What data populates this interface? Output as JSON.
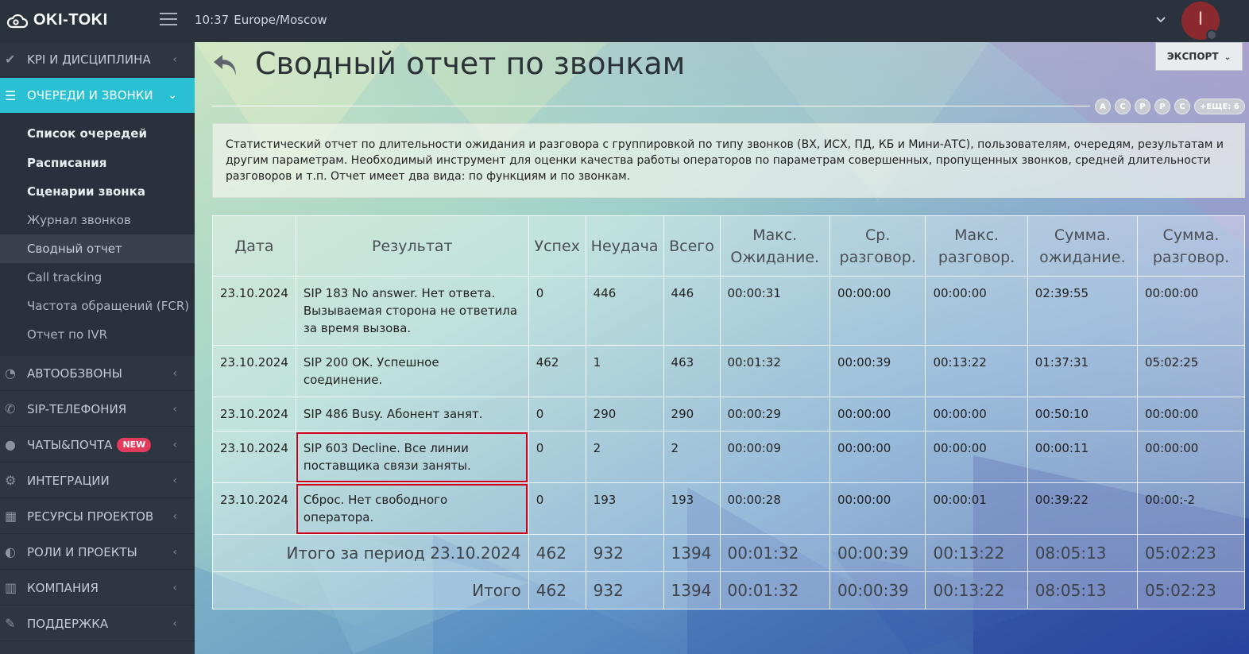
{
  "topbar": {
    "brand": "OKI-TOKI",
    "time": "10:37",
    "timezone": "Europe/Moscow",
    "user_initial": "I"
  },
  "sidebar": {
    "sections": [
      {
        "label": "KPI И ДИСЦИПЛИНА",
        "icon": "check-icon"
      },
      {
        "label": "ОЧЕРЕДИ И ЗВОНКИ",
        "icon": "list-icon",
        "active": true
      },
      {
        "label": "АВТООБЗВОНЫ",
        "icon": "clock-icon"
      },
      {
        "label": "SIP-ТЕЛЕФОНИЯ",
        "icon": "phone-icon"
      },
      {
        "label": "ЧАТЫ&ПОЧТА",
        "icon": "chat-icon",
        "badge": "NEW"
      },
      {
        "label": "ИНТЕГРАЦИИ",
        "icon": "cogs-icon"
      },
      {
        "label": "РЕСУРСЫ ПРОЕКТОВ",
        "icon": "grid-icon"
      },
      {
        "label": "РОЛИ И ПРОЕКТЫ",
        "icon": "toggle-icon"
      },
      {
        "label": "КОМПАНИЯ",
        "icon": "bar-chart-icon"
      },
      {
        "label": "ПОДДЕРЖКА",
        "icon": "wrench-icon"
      }
    ],
    "submenu": [
      {
        "label": "Список очередей",
        "bold": true
      },
      {
        "label": "Расписания",
        "bold": true
      },
      {
        "label": "Сценарии звонка",
        "bold": true
      },
      {
        "label": "Журнал звонков"
      },
      {
        "label": "Сводный отчет",
        "current": true
      },
      {
        "label": "Call tracking"
      },
      {
        "label": "Частота обращений (FCR)"
      },
      {
        "label": "Отчет по IVR"
      }
    ]
  },
  "page": {
    "title": "Сводный отчет по звонкам",
    "export_label": "ЭКСПОРТ",
    "chips": [
      "А",
      "С",
      "Р",
      "Р",
      "С"
    ],
    "chips_more": "+ЕЩЕ: 6",
    "description": "Статистический отчет по длительности ожидания и разговора с группировкой по типу звонков (ВХ, ИСХ, ПД, КБ и Мини-АТС), пользователям, очередям, результатам и другим параметрам. Необходимый инструмент для оценки качества работы операторов по параметрам совершенных, пропущенных звонков, средней длительности разговоров и т.п. Отчет имеет два вида: по функциям и по звонкам."
  },
  "table": {
    "headers": [
      "Дата",
      "Результат",
      "Успех",
      "Неудача",
      "Всего",
      "Макс. Ожидание.",
      "Ср. разговор.",
      "Макс. разговор.",
      "Сумма. ожидание.",
      "Сумма. разговор."
    ],
    "rows": [
      {
        "date": "23.10.2024",
        "result": "SIP 183 No answer. Нет ответа. Вызываемая сторона не ответила за время вызова.",
        "success": "0",
        "fail": "446",
        "total": "446",
        "max_wait": "00:00:31",
        "avg_talk": "00:00:00",
        "max_talk": "00:00:00",
        "sum_wait": "02:39:55",
        "sum_talk": "00:00:00",
        "highlight": false
      },
      {
        "date": "23.10.2024",
        "result": "SIP 200 OK. Успешное соединение.",
        "success": "462",
        "fail": "1",
        "total": "463",
        "max_wait": "00:01:32",
        "avg_talk": "00:00:39",
        "max_talk": "00:13:22",
        "sum_wait": "01:37:31",
        "sum_talk": "05:02:25",
        "highlight": false
      },
      {
        "date": "23.10.2024",
        "result": "SIP 486 Busy. Абонент занят.",
        "success": "0",
        "fail": "290",
        "total": "290",
        "max_wait": "00:00:29",
        "avg_talk": "00:00:00",
        "max_talk": "00:00:00",
        "sum_wait": "00:50:10",
        "sum_talk": "00:00:00",
        "highlight": false
      },
      {
        "date": "23.10.2024",
        "result": "SIP 603 Decline. Все линии поставщика связи заняты.",
        "success": "0",
        "fail": "2",
        "total": "2",
        "max_wait": "00:00:09",
        "avg_talk": "00:00:00",
        "max_talk": "00:00:00",
        "sum_wait": "00:00:11",
        "sum_talk": "00:00:00",
        "highlight": true
      },
      {
        "date": "23.10.2024",
        "result": "Сброс. Нет свободного оператора.",
        "success": "0",
        "fail": "193",
        "total": "193",
        "max_wait": "00:00:28",
        "avg_talk": "00:00:00",
        "max_talk": "00:00:01",
        "sum_wait": "00:39:22",
        "sum_talk": "00:00:-2",
        "highlight": true
      }
    ],
    "totals": [
      {
        "label": "Итого за период 23.10.2024",
        "success": "462",
        "fail": "932",
        "total": "1394",
        "max_wait": "00:01:32",
        "avg_talk": "00:00:39",
        "max_talk": "00:13:22",
        "sum_wait": "08:05:13",
        "sum_talk": "05:02:23"
      },
      {
        "label": "Итого",
        "success": "462",
        "fail": "932",
        "total": "1394",
        "max_wait": "00:01:32",
        "avg_talk": "00:00:39",
        "max_talk": "00:13:22",
        "sum_wait": "08:05:13",
        "sum_talk": "05:02:23"
      }
    ]
  },
  "colors": {
    "accent": "#29c0d3",
    "sidebar_bg": "#2e3642",
    "topbar_bg": "#2a323e",
    "highlight_border": "#d0021b",
    "badge": "#e23b5d"
  }
}
